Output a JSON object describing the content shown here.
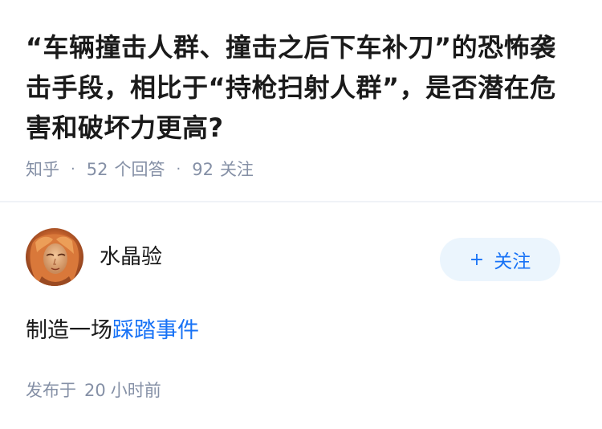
{
  "question": {
    "title": "“车辆撞击人群、撞击之后下车补刀”的恐怖袭击手段，相比于“持枪扫射人群”，是否潜在危害和破坏力更高?",
    "source": "知乎",
    "answers_count": "52",
    "answers_label": "个回答",
    "followers_count": "92",
    "followers_label": "关注"
  },
  "answer": {
    "author_name": "水晶验",
    "follow_button": {
      "icon": "+",
      "label": "关注"
    },
    "body_prefix": "制造一场",
    "body_link": "踩踏事件",
    "time_prefix": "发布于",
    "time_value": "20",
    "time_unit": "小时前"
  },
  "colors": {
    "accent": "#1772f6",
    "button_bg": "#ebf5fd",
    "meta_gray": "#8590a6",
    "text": "#1a1a1a"
  }
}
